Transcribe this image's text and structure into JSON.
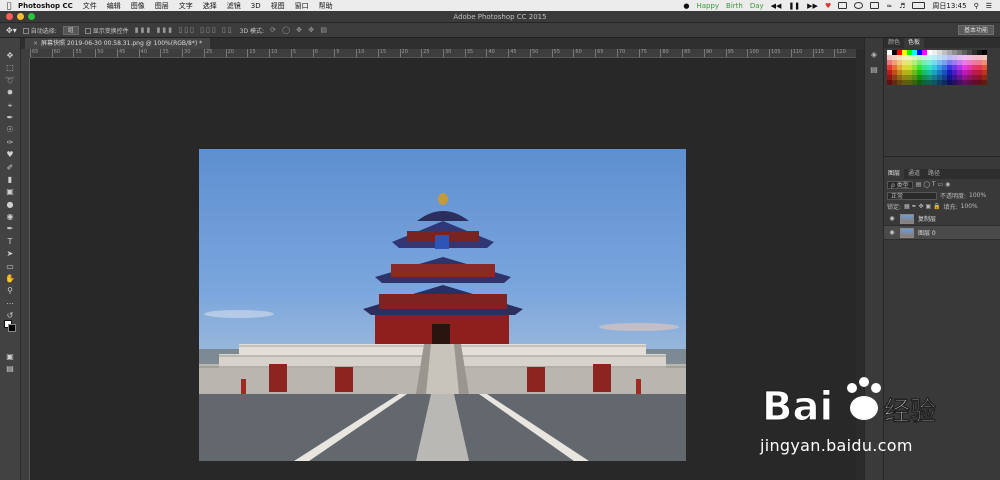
{
  "menubar": {
    "app_name": "Photoshop CC",
    "items": [
      "文件",
      "编辑",
      "图像",
      "图层",
      "文字",
      "选择",
      "滤镜",
      "3D",
      "视图",
      "窗口",
      "帮助"
    ],
    "now_playing": "Happy　Birth　Day",
    "clock": "周日13:45"
  },
  "window": {
    "title": "Adobe Photoshop CC 2015"
  },
  "options_bar": {
    "auto_select_label": "自动选择:",
    "auto_select_value": "组",
    "show_transform_label": "显示变换控件",
    "mode_3d_label": "3D 模式:",
    "workspace": "基本功能"
  },
  "document": {
    "tab_title": "屏幕快照 2019-06-30 00.58.31.png @ 100%(RGB/8*) *"
  },
  "ruler": {
    "ticks": [
      "65",
      "60",
      "55",
      "50",
      "45",
      "40",
      "35",
      "30",
      "25",
      "20",
      "15",
      "10",
      "5",
      "0",
      "5",
      "10",
      "15",
      "20",
      "25",
      "30",
      "35",
      "40",
      "45",
      "50",
      "55",
      "60",
      "65",
      "70",
      "75",
      "80",
      "85",
      "90",
      "95",
      "100",
      "105",
      "110",
      "115",
      "120"
    ]
  },
  "panels": {
    "swatches_tabs": [
      "颜色",
      "色板"
    ],
    "layers_tabs": [
      "图层",
      "通道",
      "路径"
    ],
    "kind_filter": "ρ 类型",
    "blend_mode": "正常",
    "opacity_label": "不透明度:",
    "opacity_value": "100%",
    "lock_label": "锁定:",
    "fill_label": "填充:",
    "fill_value": "100%",
    "layers": [
      {
        "name": "复制层",
        "selected": false
      },
      {
        "name": "图层 0",
        "selected": true
      }
    ]
  },
  "watermark": {
    "url": "jingyan.baidu.com"
  },
  "colors": {
    "menubar_bg": "#ececec",
    "app_bg": "#2b2b2b",
    "panel_bg": "#393939",
    "close": "#fc5f57",
    "minimize": "#fdbc2e",
    "zoom": "#28c840"
  },
  "icons": [
    "apple-logo",
    "move-tool-icon",
    "marquee-icon",
    "lasso-icon",
    "crop-icon",
    "eyedropper-icon",
    "brush-icon",
    "stamp-icon",
    "eraser-icon",
    "gradient-icon",
    "pen-icon",
    "type-icon",
    "hand-icon",
    "zoom-icon",
    "eye-icon"
  ]
}
